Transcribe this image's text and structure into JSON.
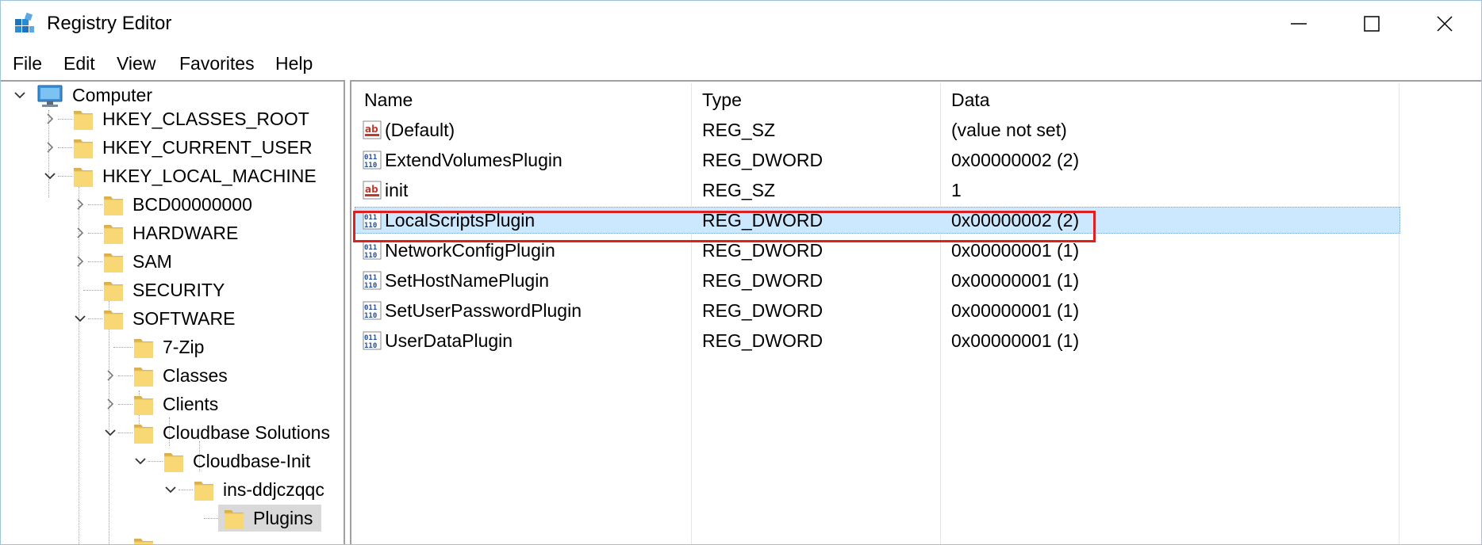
{
  "window": {
    "title": "Registry Editor",
    "app_icon": "registry-editor-icon",
    "controls": [
      "minimize-icon",
      "maximize-icon",
      "close-icon"
    ]
  },
  "menu": {
    "items": [
      "File",
      "Edit",
      "View",
      "Favorites",
      "Help"
    ]
  },
  "tree": {
    "root": "Computer",
    "hives": {
      "classes_root": "HKEY_CLASSES_ROOT",
      "current_user": "HKEY_CURRENT_USER",
      "local_machine": "HKEY_LOCAL_MACHINE"
    },
    "hklm_children": {
      "bcd": "BCD00000000",
      "hardware": "HARDWARE",
      "sam": "SAM",
      "security": "SECURITY",
      "software": "SOFTWARE"
    },
    "software_children": {
      "seven_zip": "7-Zip",
      "classes": "Classes",
      "clients": "Clients",
      "cloudbase_solutions": "Cloudbase Solutions"
    },
    "cloudbase_init": "Cloudbase-Init",
    "instance": "ins-ddjczqqc",
    "selected_key": "Plugins"
  },
  "list": {
    "columns": {
      "name": "Name",
      "type": "Type",
      "data": "Data"
    },
    "rows": [
      {
        "name": "(Default)",
        "type": "REG_SZ",
        "data": "(value not set)",
        "icon": "string-value-icon"
      },
      {
        "name": "ExtendVolumesPlugin",
        "type": "REG_DWORD",
        "data": "0x00000002 (2)",
        "icon": "binary-value-icon"
      },
      {
        "name": "init",
        "type": "REG_SZ",
        "data": "1",
        "icon": "string-value-icon"
      },
      {
        "name": "LocalScriptsPlugin",
        "type": "REG_DWORD",
        "data": "0x00000002 (2)",
        "icon": "binary-value-icon"
      },
      {
        "name": "NetworkConfigPlugin",
        "type": "REG_DWORD",
        "data": "0x00000001 (1)",
        "icon": "binary-value-icon"
      },
      {
        "name": "SetHostNamePlugin",
        "type": "REG_DWORD",
        "data": "0x00000001 (1)",
        "icon": "binary-value-icon"
      },
      {
        "name": "SetUserPasswordPlugin",
        "type": "REG_DWORD",
        "data": "0x00000001 (1)",
        "icon": "binary-value-icon"
      },
      {
        "name": "UserDataPlugin",
        "type": "REG_DWORD",
        "data": "0x00000001 (1)",
        "icon": "binary-value-icon"
      }
    ],
    "selected_row": "LocalScriptsPlugin"
  },
  "colors": {
    "selection": "#cce8ff",
    "tree_selection": "#d9d9d9",
    "highlight": "#e02020",
    "folder": "#f8d775",
    "pane_border": "#a0a0a0"
  }
}
